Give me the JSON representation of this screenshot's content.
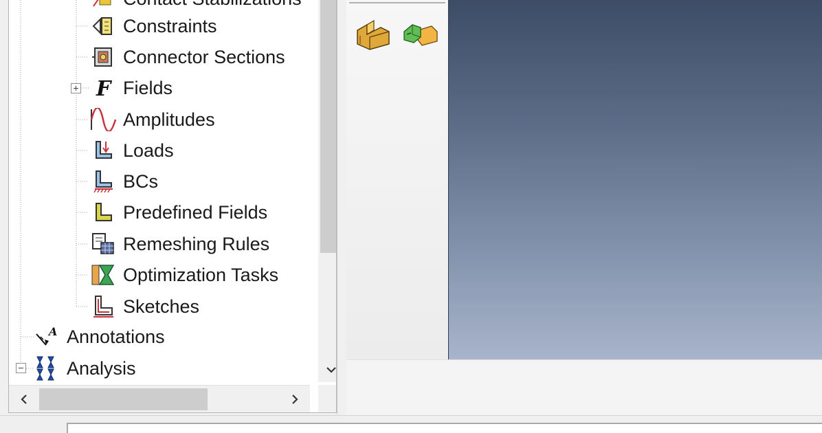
{
  "tree": {
    "partial_item": "Contact Stabilizations",
    "items": [
      {
        "label": "Constraints",
        "icon": "constraints-icon"
      },
      {
        "label": "Connector Sections",
        "icon": "connector-sections-icon"
      },
      {
        "label": "Fields",
        "icon": "fields-icon",
        "expander": "plus"
      },
      {
        "label": "Amplitudes",
        "icon": "amplitudes-icon"
      },
      {
        "label": "Loads",
        "icon": "loads-icon"
      },
      {
        "label": "BCs",
        "icon": "bcs-icon"
      },
      {
        "label": "Predefined Fields",
        "icon": "predefined-fields-icon"
      },
      {
        "label": "Remeshing Rules",
        "icon": "remeshing-rules-icon"
      },
      {
        "label": "Optimization Tasks",
        "icon": "optimization-tasks-icon"
      },
      {
        "label": "Sketches",
        "icon": "sketches-icon"
      }
    ],
    "root_items": [
      {
        "label": "Annotations",
        "icon": "annotations-icon"
      },
      {
        "label": "Analysis",
        "icon": "analysis-icon",
        "expander": "minus"
      }
    ]
  },
  "toolbox": {
    "buttons": [
      "create-part-icon",
      "part-manager-icon"
    ]
  },
  "colors": {
    "viewport_top": "#3e4c66",
    "viewport_bottom": "#a8b4cb"
  }
}
